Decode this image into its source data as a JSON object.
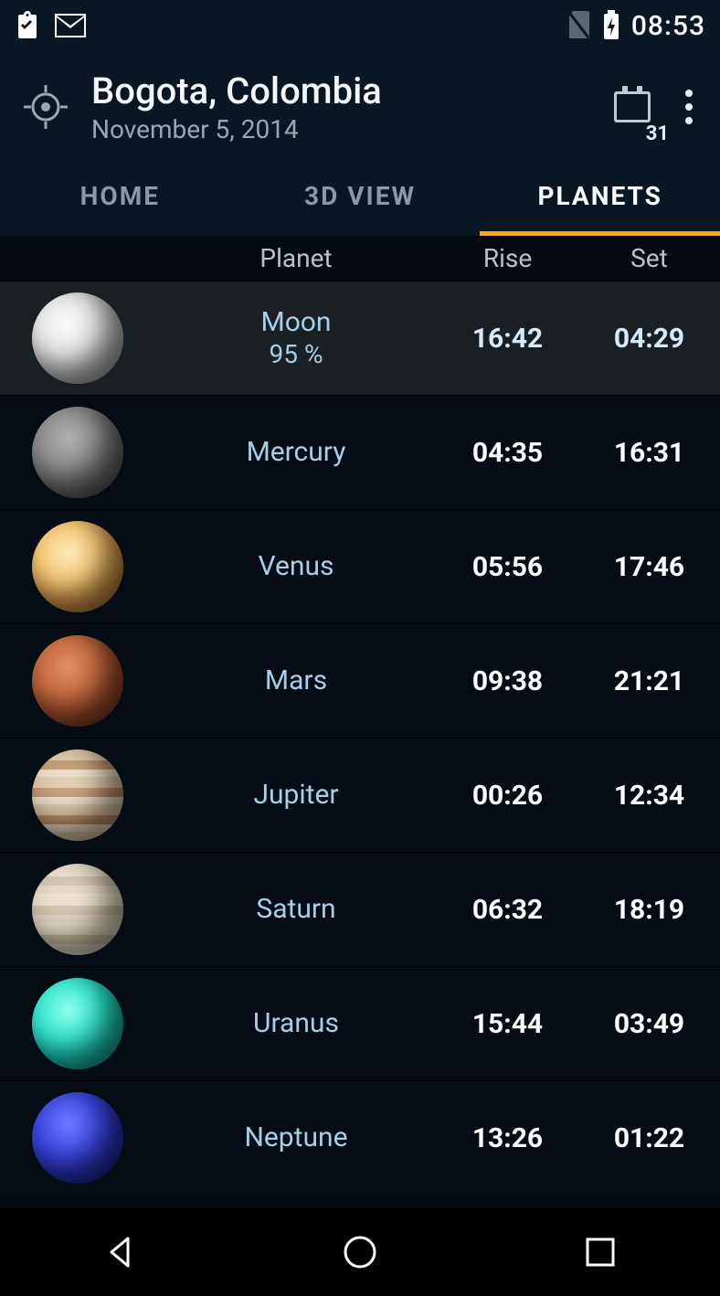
{
  "status_bar": {
    "time": "08:53",
    "icons": {
      "left": [
        "clipboard",
        "mail"
      ],
      "right": [
        "no-sim",
        "battery-charging"
      ]
    }
  },
  "header": {
    "location": "Bogota, Colombia",
    "date": "November 5, 2014",
    "calendar_day": "31"
  },
  "tabs": [
    {
      "label": "HOME",
      "active": false
    },
    {
      "label": "3D VIEW",
      "active": false
    },
    {
      "label": "PLANETS",
      "active": true
    }
  ],
  "table": {
    "columns": {
      "planet": "Planet",
      "rise": "Rise",
      "set": "Set"
    },
    "rows": [
      {
        "key": "moon",
        "name": "Moon",
        "sub": "95 %",
        "rise": "16:42",
        "set": "04:29",
        "selected": true
      },
      {
        "key": "mercury",
        "name": "Mercury",
        "sub": "",
        "rise": "04:35",
        "set": "16:31",
        "selected": false
      },
      {
        "key": "venus",
        "name": "Venus",
        "sub": "",
        "rise": "05:56",
        "set": "17:46",
        "selected": false
      },
      {
        "key": "mars",
        "name": "Mars",
        "sub": "",
        "rise": "09:38",
        "set": "21:21",
        "selected": false
      },
      {
        "key": "jupiter",
        "name": "Jupiter",
        "sub": "",
        "rise": "00:26",
        "set": "12:34",
        "selected": false
      },
      {
        "key": "saturn",
        "name": "Saturn",
        "sub": "",
        "rise": "06:32",
        "set": "18:19",
        "selected": false
      },
      {
        "key": "uranus",
        "name": "Uranus",
        "sub": "",
        "rise": "15:44",
        "set": "03:49",
        "selected": false
      },
      {
        "key": "neptune",
        "name": "Neptune",
        "sub": "",
        "rise": "13:26",
        "set": "01:22",
        "selected": false
      }
    ]
  }
}
